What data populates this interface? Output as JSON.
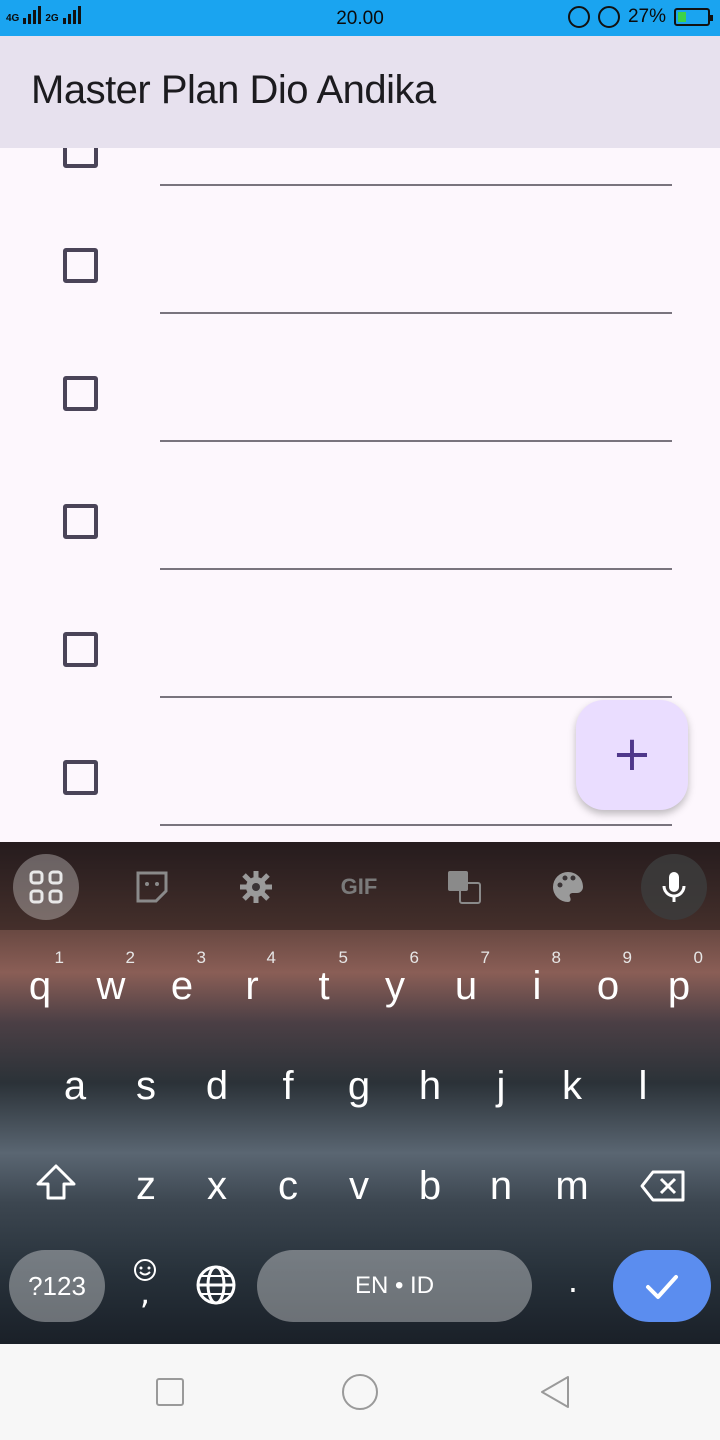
{
  "status_bar": {
    "network": [
      "4G",
      "2G"
    ],
    "time": "20.00",
    "battery": "27%",
    "battery_level": 0.27
  },
  "app_bar": {
    "title": "Master Plan Dio Andika"
  },
  "list": {
    "rows": [
      {
        "checked": false,
        "text": ""
      },
      {
        "checked": false,
        "text": ""
      },
      {
        "checked": false,
        "text": ""
      },
      {
        "checked": false,
        "text": ""
      },
      {
        "checked": false,
        "text": ""
      },
      {
        "checked": false,
        "text": ""
      }
    ]
  },
  "fab": {
    "label": "+"
  },
  "keyboard": {
    "toolbar": {
      "apps_icon": "grid-icon",
      "sticker_icon": "sticker-icon",
      "settings_icon": "gear-icon",
      "gif_label": "GIF",
      "translate_icon": "translate-icon",
      "theme_icon": "palette-icon",
      "mic_icon": "microphone-icon"
    },
    "row1": [
      {
        "key": "q",
        "hint": "1"
      },
      {
        "key": "w",
        "hint": "2"
      },
      {
        "key": "e",
        "hint": "3"
      },
      {
        "key": "r",
        "hint": "4"
      },
      {
        "key": "t",
        "hint": "5"
      },
      {
        "key": "y",
        "hint": "6"
      },
      {
        "key": "u",
        "hint": "7"
      },
      {
        "key": "i",
        "hint": "8"
      },
      {
        "key": "o",
        "hint": "9"
      },
      {
        "key": "p",
        "hint": "0"
      }
    ],
    "row2": [
      "a",
      "s",
      "d",
      "f",
      "g",
      "h",
      "j",
      "k",
      "l"
    ],
    "row3": [
      "z",
      "x",
      "c",
      "v",
      "b",
      "n",
      "m"
    ],
    "symbols_label": "?123",
    "comma_label": ",",
    "space_label": "EN • ID",
    "period_label": ".",
    "shift_icon": "shift-icon",
    "backspace_icon": "backspace-icon",
    "emoji_icon": "emoji-icon",
    "globe_icon": "globe-icon",
    "enter_icon": "checkmark-icon"
  },
  "nav_bar": {
    "recents_icon": "square-icon",
    "home_icon": "circle-icon",
    "back_icon": "triangle-back-icon"
  }
}
